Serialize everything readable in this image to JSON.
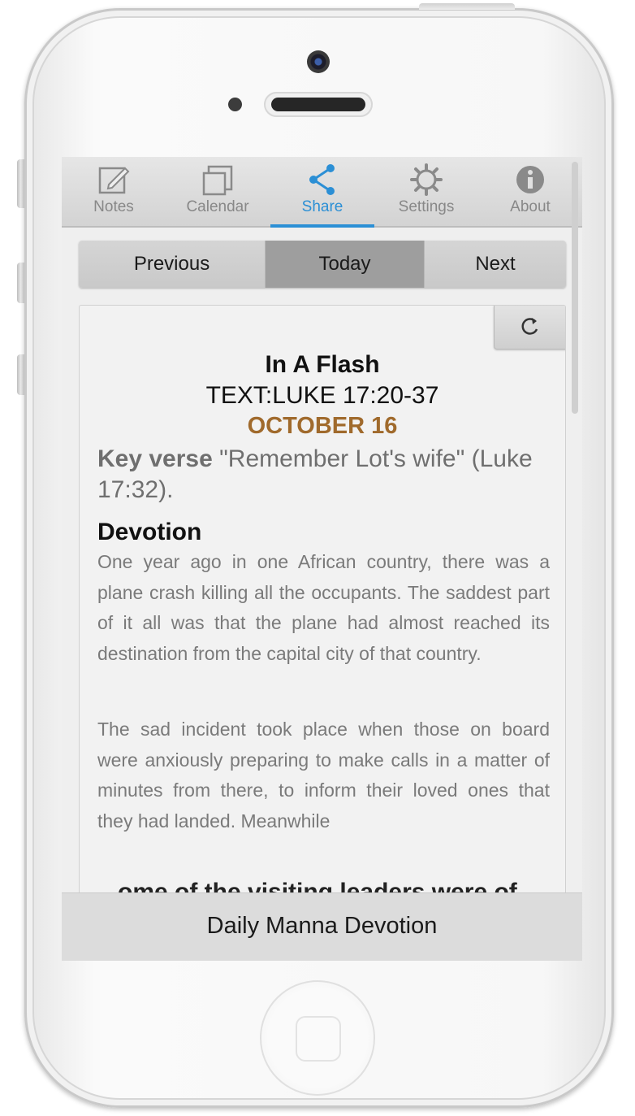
{
  "tabs": [
    {
      "label": "Notes",
      "icon": "edit-icon"
    },
    {
      "label": "Calendar",
      "icon": "calendar-icon"
    },
    {
      "label": "Share",
      "icon": "share-icon",
      "active": true
    },
    {
      "label": "Settings",
      "icon": "gear-icon"
    },
    {
      "label": "About",
      "icon": "info-icon"
    }
  ],
  "nav": {
    "previous": "Previous",
    "today": "Today",
    "next": "Next"
  },
  "devotion": {
    "title": "In A Flash",
    "text": "TEXT:LUKE 17:20-37",
    "date": "OCTOBER 16",
    "key_verse_label": "Key verse",
    "key_verse_text": " \"Remember Lot's wife\" (Luke 17:32).",
    "section_heading": "Devotion",
    "paragraphs": [
      "One year ago in one African country, there was a plane crash killing all the occupants. The saddest part of it all was that the plane had almost reached its destination from the capital city of that country.",
      "The sad incident took place when those on board were anxiously preparing to make calls in a matter of minutes from there, to inform their loved ones that they had landed. Meanwhile"
    ],
    "cutoff_text": "...ome of the visiting leaders were of"
  },
  "footer": {
    "title": "Daily Manna Devotion"
  },
  "colors": {
    "accent": "#2b8fd5",
    "date": "#a06a2c"
  }
}
